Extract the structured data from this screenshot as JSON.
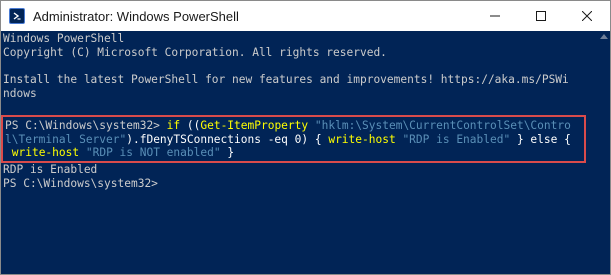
{
  "window": {
    "title": "Administrator: Windows PowerShell",
    "app_icon": "powershell-icon",
    "controls": [
      "minimize-icon",
      "maximize-icon",
      "close-icon"
    ]
  },
  "console": {
    "header_line1": "Windows PowerShell",
    "header_line2": "Copyright (C) Microsoft Corporation. All rights reserved.",
    "install_line1": "Install the latest PowerShell for new features and improvements! https://aka.ms/PSWi",
    "install_line2": "ndows",
    "command": {
      "prompt": "PS C:\\Windows\\system32> ",
      "kw_if": "if",
      "paren_open": " ((",
      "cmdlet_get": "Get-ItemProperty",
      "space1": " ",
      "path_part1": "\"hklm:\\System\\CurrentControlSet\\Contro",
      "path_part2": "l\\Terminal Server\"",
      "prop_expr": ").fDenyTSConnections -eq 0) { ",
      "write_host1": "write-host",
      "space2": " ",
      "str_enabled": "\"RDP is Enabled\"",
      "else_part": " } else {",
      "space3": " ",
      "write_host2": "write-host",
      "space4": " ",
      "str_not_enabled": "\"RDP is NOT enabled\"",
      "close_brace": " }"
    },
    "output_line": "RDP is Enabled",
    "final_prompt": "PS C:\\Windows\\system32>"
  },
  "colors": {
    "background": "#012456",
    "text": "#cccccc",
    "keyword": "#ffff00",
    "string": "#5a8fb7",
    "highlight_border": "#d94b4b"
  }
}
